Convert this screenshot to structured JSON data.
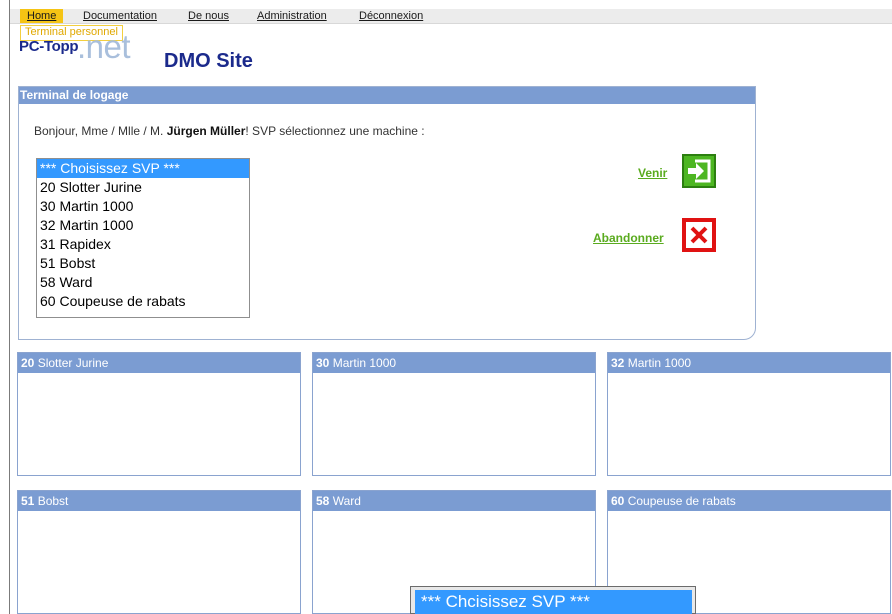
{
  "nav": {
    "items": [
      {
        "label": "Home",
        "active": true
      },
      {
        "label": "Documentation",
        "active": false
      },
      {
        "label": "De nous",
        "active": false
      },
      {
        "label": "Administration",
        "active": false
      },
      {
        "label": "Déconnexion",
        "active": false
      }
    ],
    "sublink": "Terminal personnel"
  },
  "logo": {
    "pc": "PC-Topp",
    "net": ".net",
    "site": "DMO Site"
  },
  "login_panel": {
    "title": "Terminal de logage",
    "greeting_prefix": "Bonjour, Mme / Mlle / M. ",
    "user_name": "Jürgen Müller",
    "greeting_suffix": "! SVP sélectionnez une machine :",
    "machines": [
      {
        "label": "*** Choisissez SVP ***",
        "selected": true
      },
      {
        "label": "20 Slotter Jurine",
        "selected": false
      },
      {
        "label": "30 Martin 1000",
        "selected": false
      },
      {
        "label": "32 Martin 1000",
        "selected": false
      },
      {
        "label": "31 Rapidex",
        "selected": false
      },
      {
        "label": "51 Bobst",
        "selected": false
      },
      {
        "label": "58 Ward",
        "selected": false
      },
      {
        "label": "60 Coupeuse de rabats",
        "selected": false
      }
    ],
    "come_label": "Venir",
    "abort_label": "Abandonner"
  },
  "tiles": [
    {
      "number": "20",
      "name": " Slotter Jurine"
    },
    {
      "number": "30",
      "name": " Martin 1000"
    },
    {
      "number": "32",
      "name": " Martin 1000"
    },
    {
      "number": "51",
      "name": " Bobst"
    },
    {
      "number": "58",
      "name": " Ward"
    },
    {
      "number": "60",
      "name": " Coupeuse de rabats"
    }
  ],
  "dropdown_popup": {
    "selected_label": "*** Chcisissez SVP ***"
  },
  "colors": {
    "nav_active": "#f5c414",
    "panel_header": "#7b9cd2",
    "brand_dark": "#1b2a8c",
    "brand_light": "#a9bfdc",
    "action_green": "#5aab1f",
    "abort_red": "#e01212",
    "selection_blue": "#3399ff"
  },
  "icons": {
    "come": "enter-arrow-icon",
    "abort": "close-x-icon"
  }
}
